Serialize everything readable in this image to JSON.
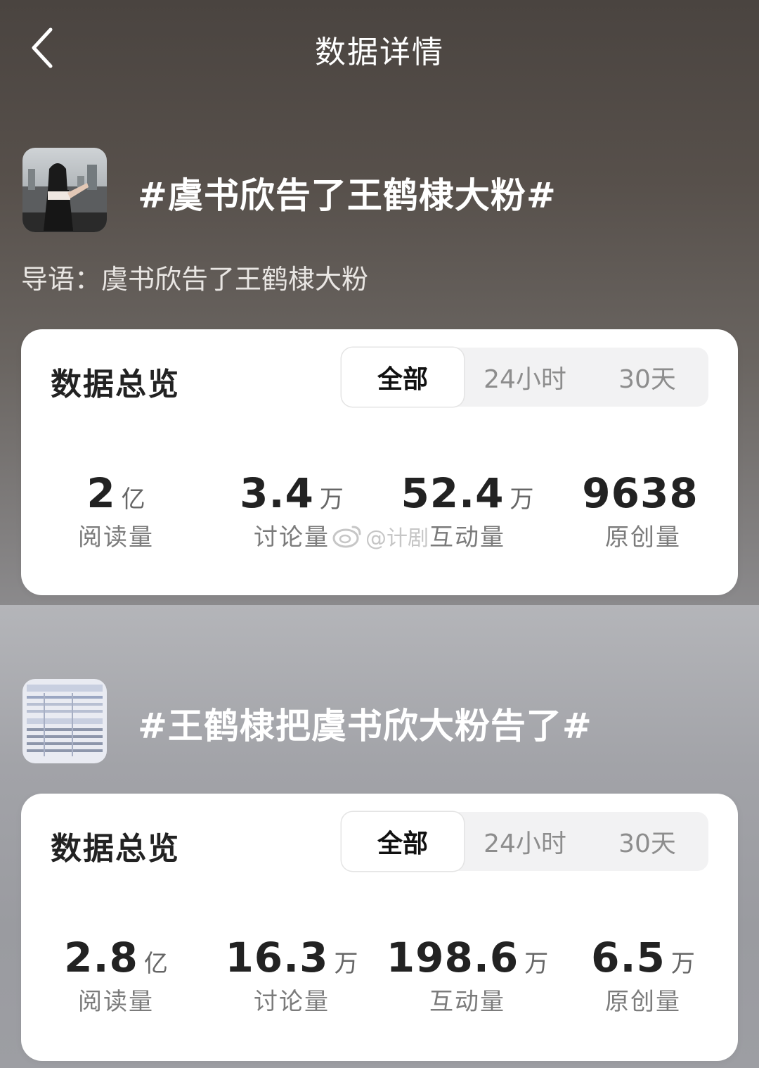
{
  "nav": {
    "title": "数据详情"
  },
  "topics": [
    {
      "title": "#虞书欣告了王鹤棣大粉#",
      "lead": "导语：虞书欣告了王鹤棣大粉",
      "overview_title": "数据总览",
      "tabs": [
        "全部",
        "24小时",
        "30天"
      ],
      "selected_tab": "全部",
      "stats": [
        {
          "value": "2",
          "unit": "亿",
          "label": "阅读量"
        },
        {
          "value": "3.4",
          "unit": "万",
          "label": "讨论量"
        },
        {
          "value": "52.4",
          "unit": "万",
          "label": "互动量"
        },
        {
          "value": "9638",
          "unit": "",
          "label": "原创量"
        }
      ]
    },
    {
      "title": "#王鹤棣把虞书欣大粉告了#",
      "overview_title": "数据总览",
      "tabs": [
        "全部",
        "24小时",
        "30天"
      ],
      "selected_tab": "全部",
      "stats": [
        {
          "value": "2.8",
          "unit": "亿",
          "label": "阅读量"
        },
        {
          "value": "16.3",
          "unit": "万",
          "label": "讨论量"
        },
        {
          "value": "198.6",
          "unit": "万",
          "label": "互动量"
        },
        {
          "value": "6.5",
          "unit": "万",
          "label": "原创量"
        }
      ]
    }
  ],
  "watermark": {
    "text": "@计剧",
    "icon": "weibo-logo"
  },
  "icons": {
    "back": "chevron-left-icon"
  },
  "colors": {
    "card_bg": "#ffffff",
    "active_tab": "#ffffff",
    "segmented_bg": "#f2f2f3"
  }
}
